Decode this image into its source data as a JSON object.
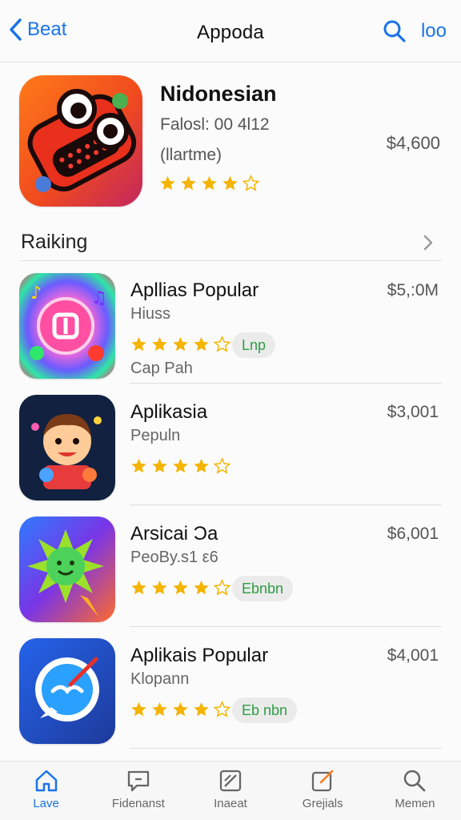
{
  "header": {
    "back_label": "Beat",
    "title": "Appoda",
    "right_label": "loo"
  },
  "featured": {
    "title": "Nidonesian",
    "subtitle": "Falosl: 00 4l12",
    "subtitle2": "(llartme)",
    "price": "$4,600",
    "rating": 4
  },
  "ranking": {
    "label": "Raiking"
  },
  "apps": [
    {
      "name": "Apllias Popular",
      "subtitle": "Hiuss",
      "price": "$5,:0M",
      "rating": 4,
      "pill": "Lnp",
      "subtitle2": "Cap Pah"
    },
    {
      "name": "Aplikasia",
      "subtitle": "Pepuln",
      "price": "$3,001",
      "rating": 4,
      "pill": "",
      "subtitle2": ""
    },
    {
      "name": "Arsicai Ɔa",
      "subtitle": "PeoBy.s1 ε6",
      "price": "$6,001",
      "rating": 4,
      "pill": "Ebnbn",
      "subtitle2": ""
    },
    {
      "name": "Aplikais Popular",
      "subtitle": "Klopann",
      "price": "$4,001",
      "rating": 4,
      "pill": "Eb nbn",
      "subtitle2": ""
    }
  ],
  "tabbar": {
    "items": [
      {
        "label": "Lave",
        "icon": "home-icon",
        "active": true
      },
      {
        "label": "Fidenanst",
        "icon": "chat-icon",
        "active": false
      },
      {
        "label": "Inaeat",
        "icon": "edit-icon",
        "active": false
      },
      {
        "label": "Grejials",
        "icon": "compose-icon",
        "active": false
      },
      {
        "label": "Memen",
        "icon": "search-icon",
        "active": false
      }
    ]
  },
  "colors": {
    "accent": "#1a73e8",
    "star": "#f4b400",
    "pill_text": "#2f9e44"
  }
}
